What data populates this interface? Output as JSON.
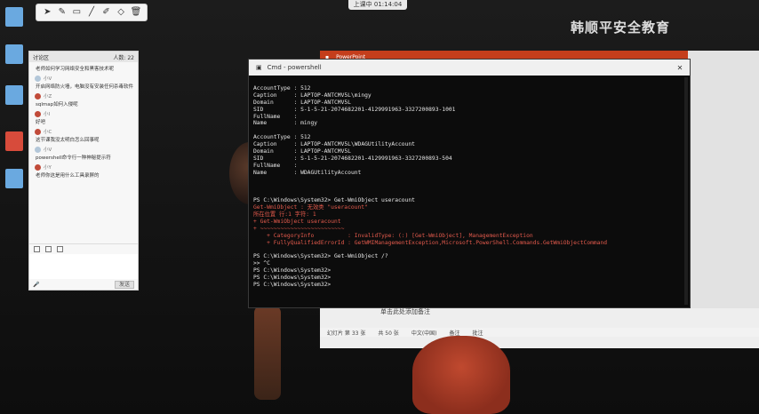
{
  "recording_bar": {
    "label": "上课中 01:14:04"
  },
  "watermark": {
    "text": "韩顺平安全教育"
  },
  "toolbar": {
    "icons": [
      "cursor-icon",
      "pen-icon",
      "rect-icon",
      "line-icon",
      "marker-icon",
      "eraser-icon",
      "clear-icon"
    ]
  },
  "chat": {
    "title": "讨论区",
    "count": "人数: 22",
    "messages": [
      {
        "user": "",
        "text": "老师如何学习网络安全和黑客技术呢"
      },
      {
        "user": "小V",
        "text": "开启网络防火墙，电脑没有安装任何杀毒软件"
      },
      {
        "user": "小Z",
        "text": "sqlmap如何入侵呢"
      },
      {
        "user": "小I",
        "text": "好吧"
      },
      {
        "user": "小C",
        "text": "这节课我没太明白怎么回事呢"
      },
      {
        "user": "小V",
        "text": "powershell命令行一种神秘提示符"
      },
      {
        "user": "小Y",
        "text": "老师你这是用什么工具录屏的"
      }
    ],
    "send_label": "发送"
  },
  "ppt": {
    "title": "PowerPoint",
    "notes_placeholder": "单击此处添加备注",
    "status": [
      "幻灯片 第 33 张",
      "共 50 张",
      "中文(中国)",
      "备注",
      "批注"
    ]
  },
  "powershell": {
    "title": "Cmd - powershell",
    "lines": [
      {
        "text": "AccountType : 512",
        "type": "normal"
      },
      {
        "text": "Caption     : LAPTOP-ANTCMV5L\\mingy",
        "type": "normal"
      },
      {
        "text": "Domain      : LAPTOP-ANTCMV5L",
        "type": "normal"
      },
      {
        "text": "SID         : S-1-5-21-2074682201-4129991963-3327200893-1001",
        "type": "normal"
      },
      {
        "text": "FullName    :",
        "type": "normal"
      },
      {
        "text": "Name        : mingy",
        "type": "normal"
      },
      {
        "text": "",
        "type": "normal"
      },
      {
        "text": "AccountType : 512",
        "type": "normal"
      },
      {
        "text": "Caption     : LAPTOP-ANTCMV5L\\WDAGUtilityAccount",
        "type": "normal"
      },
      {
        "text": "Domain      : LAPTOP-ANTCMV5L",
        "type": "normal"
      },
      {
        "text": "SID         : S-1-5-21-2074682201-4129991963-3327200893-504",
        "type": "normal"
      },
      {
        "text": "FullName    :",
        "type": "normal"
      },
      {
        "text": "Name        : WDAGUtilityAccount",
        "type": "normal"
      },
      {
        "text": "",
        "type": "normal"
      },
      {
        "text": "",
        "type": "normal"
      },
      {
        "text": "",
        "type": "normal"
      },
      {
        "text": "PS C:\\Windows\\System32> Get-WmiObject useracount",
        "type": "normal"
      },
      {
        "text": "Get-WmiObject : 无效类 \"useracount\"",
        "type": "error"
      },
      {
        "text": "所在位置 行:1 字符: 1",
        "type": "error"
      },
      {
        "text": "+ Get-WmiObject useracount",
        "type": "error"
      },
      {
        "text": "+ ~~~~~~~~~~~~~~~~~~~~~~~~~",
        "type": "error"
      },
      {
        "text": "    + CategoryInfo          : InvalidType: (:) [Get-WmiObject], ManagementException",
        "type": "error"
      },
      {
        "text": "    + FullyQualifiedErrorId : GetWMIManagementException,Microsoft.PowerShell.Commands.GetWmiObjectCommand",
        "type": "error"
      },
      {
        "text": "",
        "type": "normal"
      },
      {
        "text": "PS C:\\Windows\\System32> Get-WmiObject /?",
        "type": "normal"
      },
      {
        "text": ">> ^C",
        "type": "normal"
      },
      {
        "text": "PS C:\\Windows\\System32>",
        "type": "normal"
      },
      {
        "text": "PS C:\\Windows\\System32>",
        "type": "normal"
      },
      {
        "text": "PS C:\\Windows\\System32>",
        "type": "normal"
      }
    ]
  }
}
